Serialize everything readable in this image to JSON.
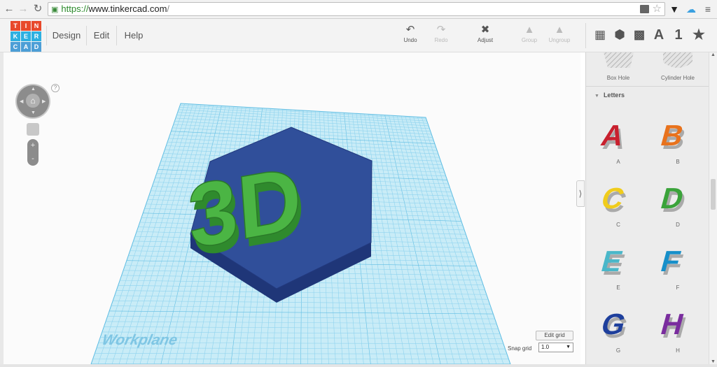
{
  "browser": {
    "url_protocol": "https://",
    "url_host": "www.tinkercad.com",
    "url_path": "/"
  },
  "app": {
    "logo_letters": [
      "T",
      "I",
      "N",
      "K",
      "E",
      "R",
      "C",
      "A",
      "D"
    ],
    "logo_colors": [
      "#e8492b",
      "#e8492b",
      "#e8492b",
      "#2db0e1",
      "#2db0e1",
      "#2db0e1",
      "#4c9ed6",
      "#4c9ed6",
      "#4c9ed6"
    ],
    "menu": [
      "Design",
      "Edit",
      "Help"
    ]
  },
  "toolbar": {
    "undo": "Undo",
    "redo": "Redo",
    "adjust": "Adjust",
    "group": "Group",
    "ungroup": "Ungroup",
    "text_tool": "A",
    "number_tool": "1"
  },
  "viewport": {
    "model_text": "3D",
    "workplane_label": "Workplane",
    "edit_grid": "Edit grid",
    "snap_grid_label": "Snap grid",
    "snap_grid_value": "1.0",
    "help": "?",
    "zoom_in": "+",
    "zoom_out": "-"
  },
  "panel": {
    "holes": [
      "Box Hole",
      "Cylinder Hole"
    ],
    "section": "Letters",
    "letters": [
      {
        "label": "A",
        "color": "#c8202e"
      },
      {
        "label": "B",
        "color": "#e8721c"
      },
      {
        "label": "C",
        "color": "#f0cc1c"
      },
      {
        "label": "D",
        "color": "#3aa33a"
      },
      {
        "label": "E",
        "color": "#4ab7c9"
      },
      {
        "label": "F",
        "color": "#178fc9"
      },
      {
        "label": "G",
        "color": "#1e3f9c"
      },
      {
        "label": "H",
        "color": "#7a2d9e"
      }
    ]
  },
  "colors": {
    "workplane_fill": "#c9ecf7",
    "workplane_grid": "#8fd3ee",
    "hexagon_top": "#304f9a",
    "hexagon_side": "#1f3678",
    "text_top": "#4bb544",
    "text_side": "#2f8a2d"
  }
}
